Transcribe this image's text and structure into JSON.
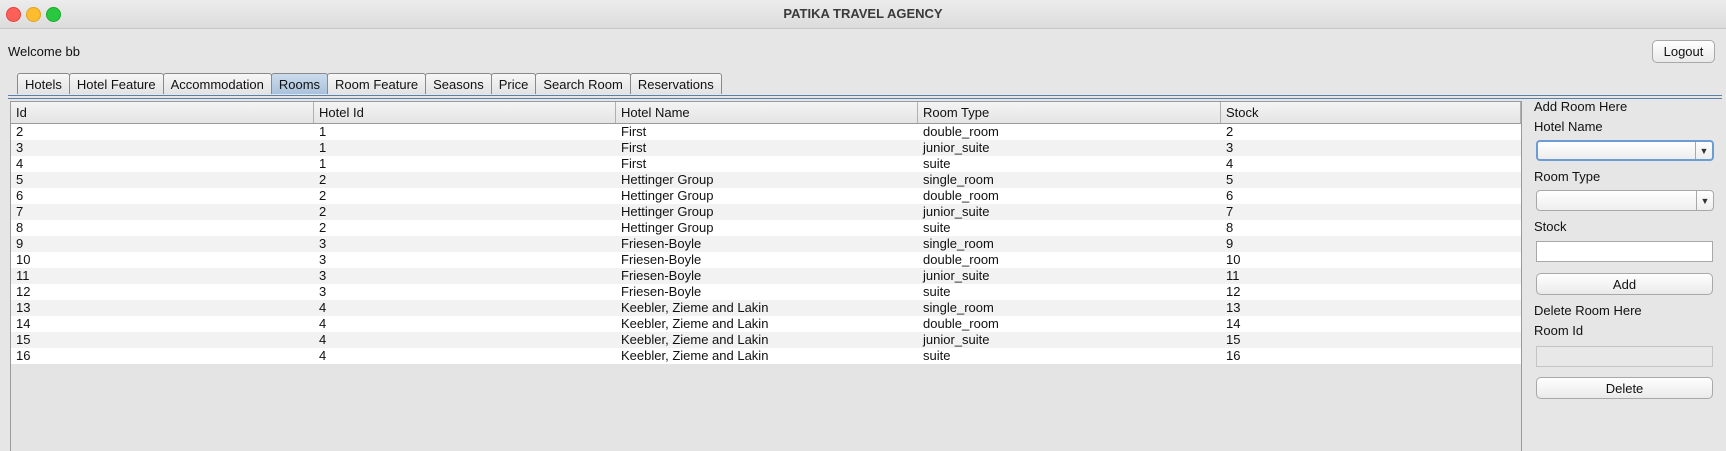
{
  "window": {
    "title": "PATIKA TRAVEL AGENCY"
  },
  "header": {
    "welcome": "Welcome bb",
    "logout_label": "Logout"
  },
  "tabs": [
    {
      "label": "Hotels"
    },
    {
      "label": "Hotel Feature"
    },
    {
      "label": "Accommodation"
    },
    {
      "label": "Rooms",
      "active": true
    },
    {
      "label": "Room Feature"
    },
    {
      "label": "Seasons"
    },
    {
      "label": "Price"
    },
    {
      "label": "Search Room"
    },
    {
      "label": "Reservations"
    }
  ],
  "table": {
    "columns": [
      "Id",
      "Hotel Id",
      "Hotel Name",
      "Room Type",
      "Stock"
    ],
    "rows": [
      [
        "2",
        "1",
        "First",
        "double_room",
        "2"
      ],
      [
        "3",
        "1",
        "First",
        "junior_suite",
        "3"
      ],
      [
        "4",
        "1",
        "First",
        "suite",
        "4"
      ],
      [
        "5",
        "2",
        "Hettinger Group",
        "single_room",
        "5"
      ],
      [
        "6",
        "2",
        "Hettinger Group",
        "double_room",
        "6"
      ],
      [
        "7",
        "2",
        "Hettinger Group",
        "junior_suite",
        "7"
      ],
      [
        "8",
        "2",
        "Hettinger Group",
        "suite",
        "8"
      ],
      [
        "9",
        "3",
        "Friesen-Boyle",
        "single_room",
        "9"
      ],
      [
        "10",
        "3",
        "Friesen-Boyle",
        "double_room",
        "10"
      ],
      [
        "11",
        "3",
        "Friesen-Boyle",
        "junior_suite",
        "11"
      ],
      [
        "12",
        "3",
        "Friesen-Boyle",
        "suite",
        "12"
      ],
      [
        "13",
        "4",
        "Keebler, Zieme and Lakin",
        "single_room",
        "13"
      ],
      [
        "14",
        "4",
        "Keebler, Zieme and Lakin",
        "double_room",
        "14"
      ],
      [
        "15",
        "4",
        "Keebler, Zieme and Lakin",
        "junior_suite",
        "15"
      ],
      [
        "16",
        "4",
        "Keebler, Zieme and Lakin",
        "suite",
        "16"
      ]
    ]
  },
  "add_panel": {
    "heading": "Add Room Here",
    "hotel_name_label": "Hotel Name",
    "hotel_name_value": "",
    "room_type_label": "Room Type",
    "room_type_value": "",
    "stock_label": "Stock",
    "stock_value": "",
    "add_label": "Add"
  },
  "delete_panel": {
    "heading": "Delete Room Here",
    "room_id_label": "Room Id",
    "room_id_value": "",
    "delete_label": "Delete"
  },
  "icons": {
    "close": "close-icon",
    "minimize": "minimize-icon",
    "zoom": "zoom-icon",
    "dropdown": "chevron-down-icon"
  },
  "colors": {
    "close": "#fe5f57",
    "minimize": "#febc2e",
    "zoom": "#28c840",
    "active_tab": "#b9cfe4",
    "focus_ring": "#6c9bd6"
  }
}
